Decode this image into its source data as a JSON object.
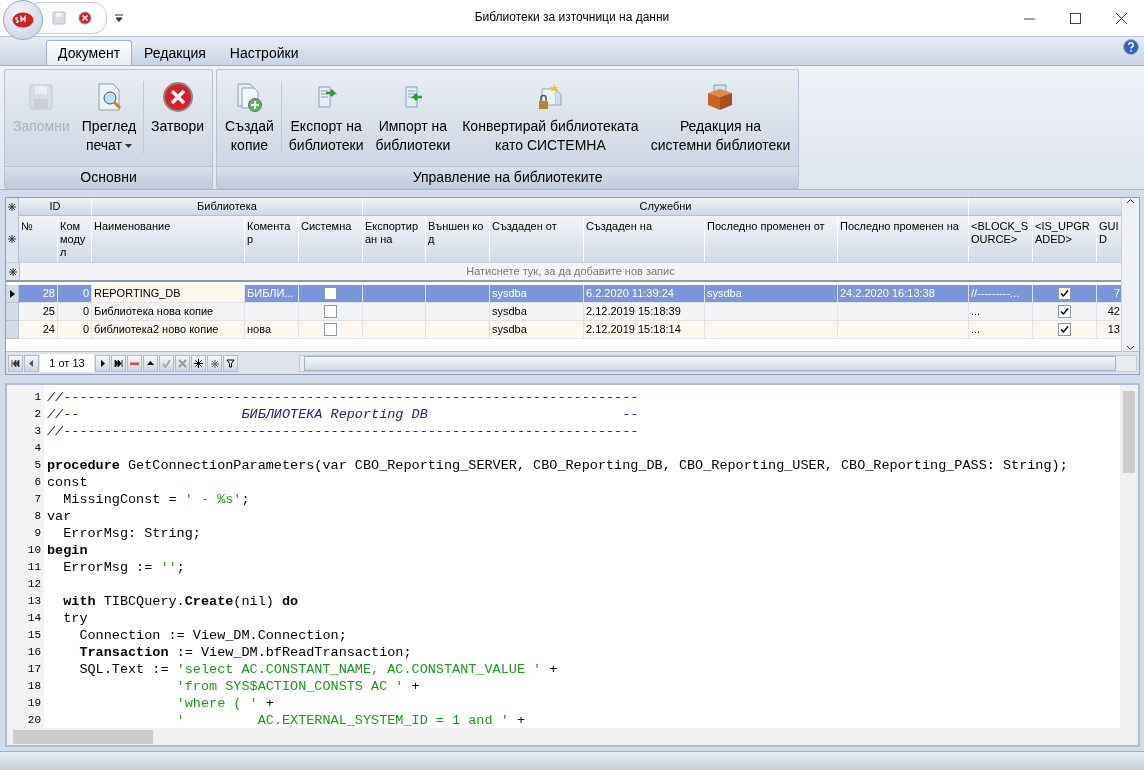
{
  "window": {
    "title": "Библиотеки за източници на данни"
  },
  "ribbon": {
    "tabs": [
      {
        "label": "Документ",
        "selected": true
      },
      {
        "label": "Редакция",
        "selected": false
      },
      {
        "label": "Настройки",
        "selected": false
      }
    ],
    "groups": [
      {
        "label": "Основни",
        "buttons": [
          {
            "kind": "save",
            "lines": [
              "Запомни"
            ],
            "disabled": true,
            "dropdown": false
          },
          {
            "kind": "preview",
            "lines": [
              "Преглед",
              "печат"
            ],
            "disabled": false,
            "dropdown": true
          },
          {
            "kind": "close",
            "lines": [
              "Затвори"
            ],
            "disabled": false,
            "dropdown": false
          }
        ]
      },
      {
        "label": "Управление на библиотеките",
        "buttons": [
          {
            "kind": "copy",
            "lines": [
              "Създай",
              "копие"
            ],
            "disabled": false,
            "dropdown": false
          },
          {
            "kind": "export",
            "lines": [
              "Експорт на",
              "библиотеки"
            ],
            "disabled": false,
            "dropdown": false
          },
          {
            "kind": "import",
            "lines": [
              "Импорт на",
              "библиотеки"
            ],
            "disabled": false,
            "dropdown": false
          },
          {
            "kind": "convert",
            "lines": [
              "Конвертирай библиотеката",
              "като СИСТЕМНА"
            ],
            "disabled": false,
            "dropdown": false
          },
          {
            "kind": "box",
            "lines": [
              "Редакция на",
              "системни библиотеки"
            ],
            "disabled": false,
            "dropdown": false
          }
        ]
      }
    ]
  },
  "grid": {
    "bands": [
      {
        "label": "ID"
      },
      {
        "label": "Библиотека"
      },
      {
        "label": "Служебни"
      }
    ],
    "columns": [
      {
        "label": "№",
        "kind": "num"
      },
      {
        "label": "Ком модул",
        "kind": "num"
      },
      {
        "label": "Наименование",
        "kind": "text"
      },
      {
        "label": "Коментар",
        "kind": "text"
      },
      {
        "label": "Системна",
        "kind": "check"
      },
      {
        "label": "Експортиран на",
        "kind": "text"
      },
      {
        "label": "Външен код",
        "kind": "text"
      },
      {
        "label": "Създаден от",
        "kind": "text"
      },
      {
        "label": "Създаден на",
        "kind": "text"
      },
      {
        "label": "Последно променен от",
        "kind": "text"
      },
      {
        "label": "Последно променен на",
        "kind": "text"
      },
      {
        "label": "<BLOCK_SOURCE>",
        "kind": "text"
      },
      {
        "label": "<IS_UPGRADED>",
        "kind": "check"
      },
      {
        "label": "GUID",
        "kind": "num"
      }
    ],
    "new_row_hint": "Натиснете тук, за да добавите нов запис",
    "rows": [
      {
        "selected": true,
        "cells": [
          "28",
          "0",
          "REPORTING_DB",
          "БИБЛИ...",
          false,
          "",
          "",
          "sysdba",
          "6.2.2020 11:39:24",
          "sysdba",
          "24.2.2020 16:13:38",
          "//---------...",
          true,
          "7"
        ]
      },
      {
        "selected": false,
        "cells": [
          "25",
          "0",
          "Библиотека нова копие",
          "",
          false,
          "",
          "",
          "sysdba",
          "2.12.2019 15:18:39",
          "",
          "",
          "...",
          true,
          "42"
        ]
      },
      {
        "selected": false,
        "cells": [
          "24",
          "0",
          "библиотека2 ново копие",
          "нова",
          false,
          "",
          "",
          "sysdba",
          "2.12.2019 15:18:14",
          "",
          "",
          "...",
          true,
          "13"
        ]
      }
    ],
    "navigator": {
      "position": "1 от 13"
    }
  },
  "editor": {
    "lines": [
      {
        "number": "1",
        "tokens": [
          {
            "kind": "comment",
            "text": "//-----------------------------------------------------------------------"
          }
        ]
      },
      {
        "number": "2",
        "tokens": [
          {
            "kind": "comment",
            "text": "//--                    БИБЛИОТЕКА Reporting DB                        --"
          }
        ]
      },
      {
        "number": "3",
        "tokens": [
          {
            "kind": "comment",
            "text": "//-----------------------------------------------------------------------"
          }
        ]
      },
      {
        "number": "4"
      },
      {
        "number": "5",
        "tokens": [
          {
            "kind": "keyword",
            "text": "procedure"
          },
          {
            "kind": "plain",
            "text": " GetConnectionParameters(var CBO_Reporting_SERVER, CBO_Reporting_DB, CBO_Reporting_USER, CBO_Reporting_PASS: String);"
          }
        ]
      },
      {
        "number": "6",
        "tokens": [
          {
            "kind": "plain",
            "text": "const"
          }
        ]
      },
      {
        "number": "7",
        "tokens": [
          {
            "kind": "plain",
            "text": "  MissingConst = "
          },
          {
            "kind": "string",
            "text": "' - %s'"
          },
          {
            "kind": "plain",
            "text": ";"
          }
        ]
      },
      {
        "number": "8",
        "tokens": [
          {
            "kind": "plain",
            "text": "var"
          }
        ]
      },
      {
        "number": "9",
        "tokens": [
          {
            "kind": "plain",
            "text": "  ErrorMsg: String;"
          }
        ]
      },
      {
        "number": "10",
        "tokens": [
          {
            "kind": "keyword",
            "text": "begin"
          }
        ]
      },
      {
        "number": "11",
        "tokens": [
          {
            "kind": "plain",
            "text": "  ErrorMsg := "
          },
          {
            "kind": "string",
            "text": "''"
          },
          {
            "kind": "plain",
            "text": ";"
          }
        ]
      },
      {
        "number": "12"
      },
      {
        "number": "13",
        "tokens": [
          {
            "kind": "keyword",
            "text": "  with"
          },
          {
            "kind": "plain",
            "text": " TIBCQuery."
          },
          {
            "kind": "keyword",
            "text": "Create"
          },
          {
            "kind": "plain",
            "text": "(nil) "
          },
          {
            "kind": "keyword",
            "text": "do"
          }
        ]
      },
      {
        "number": "14",
        "tokens": [
          {
            "kind": "plain",
            "text": "  try"
          }
        ]
      },
      {
        "number": "15",
        "tokens": [
          {
            "kind": "plain",
            "text": "    Connection := View_DM.Connection;"
          }
        ]
      },
      {
        "number": "16",
        "tokens": [
          {
            "kind": "keyword",
            "text": "    Transaction"
          },
          {
            "kind": "plain",
            "text": " := View_DM.bfReadTransaction;"
          }
        ]
      },
      {
        "number": "17",
        "tokens": [
          {
            "kind": "plain",
            "text": "    SQL.Text := "
          },
          {
            "kind": "string",
            "text": "'select AC.CONSTANT_NAME, AC.CONSTANT_VALUE '"
          },
          {
            "kind": "plain",
            "text": " +"
          }
        ]
      },
      {
        "number": "18",
        "tokens": [
          {
            "kind": "string",
            "text": "                'from SYS$ACTION_CONSTS AC '"
          },
          {
            "kind": "plain",
            "text": " +"
          }
        ]
      },
      {
        "number": "19",
        "tokens": [
          {
            "kind": "string",
            "text": "                'where ( '"
          },
          {
            "kind": "plain",
            "text": " +"
          }
        ]
      },
      {
        "number": "20",
        "tokens": [
          {
            "kind": "string",
            "text": "                '         AC.EXTERNAL_SYSTEM_ID = 1 and '"
          },
          {
            "kind": "plain",
            "text": " +"
          }
        ]
      }
    ]
  }
}
